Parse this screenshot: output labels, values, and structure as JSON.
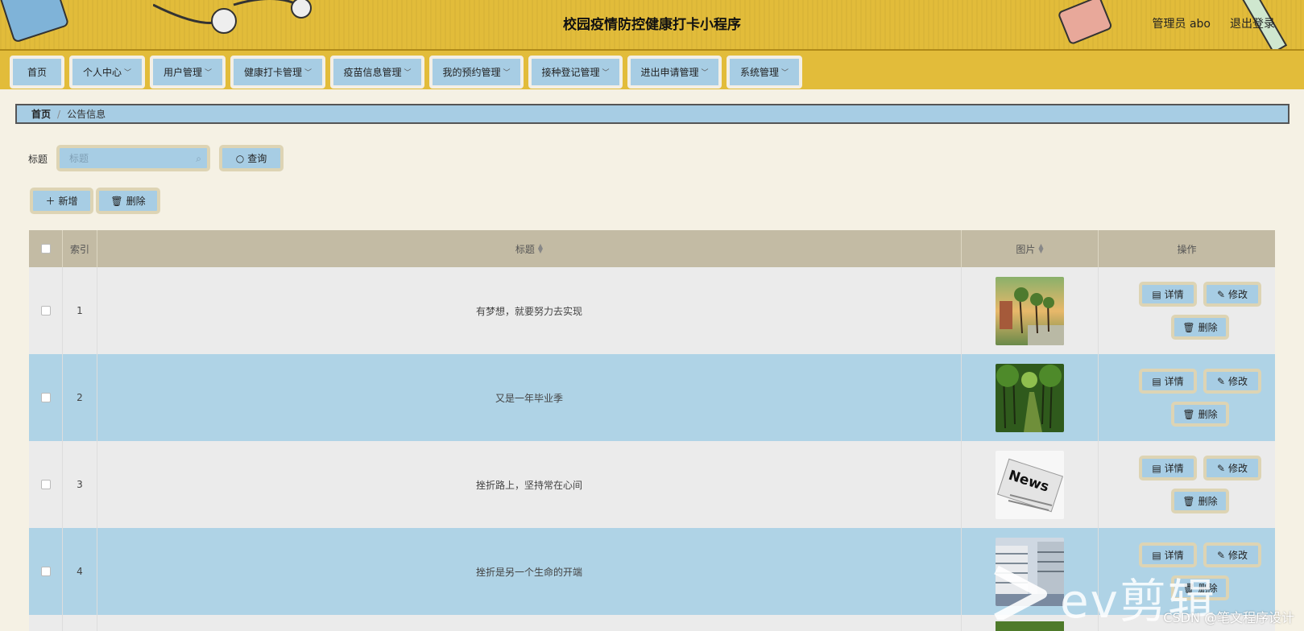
{
  "header": {
    "title": "校园疫情防控健康打卡小程序",
    "user": "管理员 abo",
    "logout": "退出登录"
  },
  "nav": [
    {
      "label": "首页",
      "dropdown": false
    },
    {
      "label": "个人中心",
      "dropdown": true
    },
    {
      "label": "用户管理",
      "dropdown": true
    },
    {
      "label": "健康打卡管理",
      "dropdown": true
    },
    {
      "label": "疫苗信息管理",
      "dropdown": true
    },
    {
      "label": "我的预约管理",
      "dropdown": true
    },
    {
      "label": "接种登记管理",
      "dropdown": true
    },
    {
      "label": "进出申请管理",
      "dropdown": true
    },
    {
      "label": "系统管理",
      "dropdown": true
    }
  ],
  "breadcrumb": {
    "home": "首页",
    "separator": "/",
    "current": "公告信息"
  },
  "search": {
    "label": "标题",
    "placeholder": "标题",
    "button": "查询"
  },
  "toolbar": {
    "add": "新增",
    "delete": "删除"
  },
  "table": {
    "columns": {
      "index": "索引",
      "title": "标题",
      "image": "图片",
      "actions": "操作"
    },
    "rows": [
      {
        "index": "1",
        "title": "有梦想，就要努力去实现",
        "image": "campus-street-photo"
      },
      {
        "index": "2",
        "title": "又是一年毕业季",
        "image": "tree-path-photo"
      },
      {
        "index": "3",
        "title": "挫折路上，坚持常在心间",
        "image": "news-paper-photo"
      },
      {
        "index": "4",
        "title": "挫折是另一个生命的开端",
        "image": "building-photo"
      }
    ],
    "row_actions": {
      "detail": "详情",
      "edit": "修改",
      "delete": "删除"
    }
  },
  "overlay": {
    "logo": "ev剪辑",
    "watermark": "CSDN @笔文程序设计"
  },
  "colors": {
    "header_bg": "#e2bc3a",
    "accent_blue": "#a7cde4",
    "page_bg": "#f5f1e4",
    "header_row": "#c3bba4"
  }
}
